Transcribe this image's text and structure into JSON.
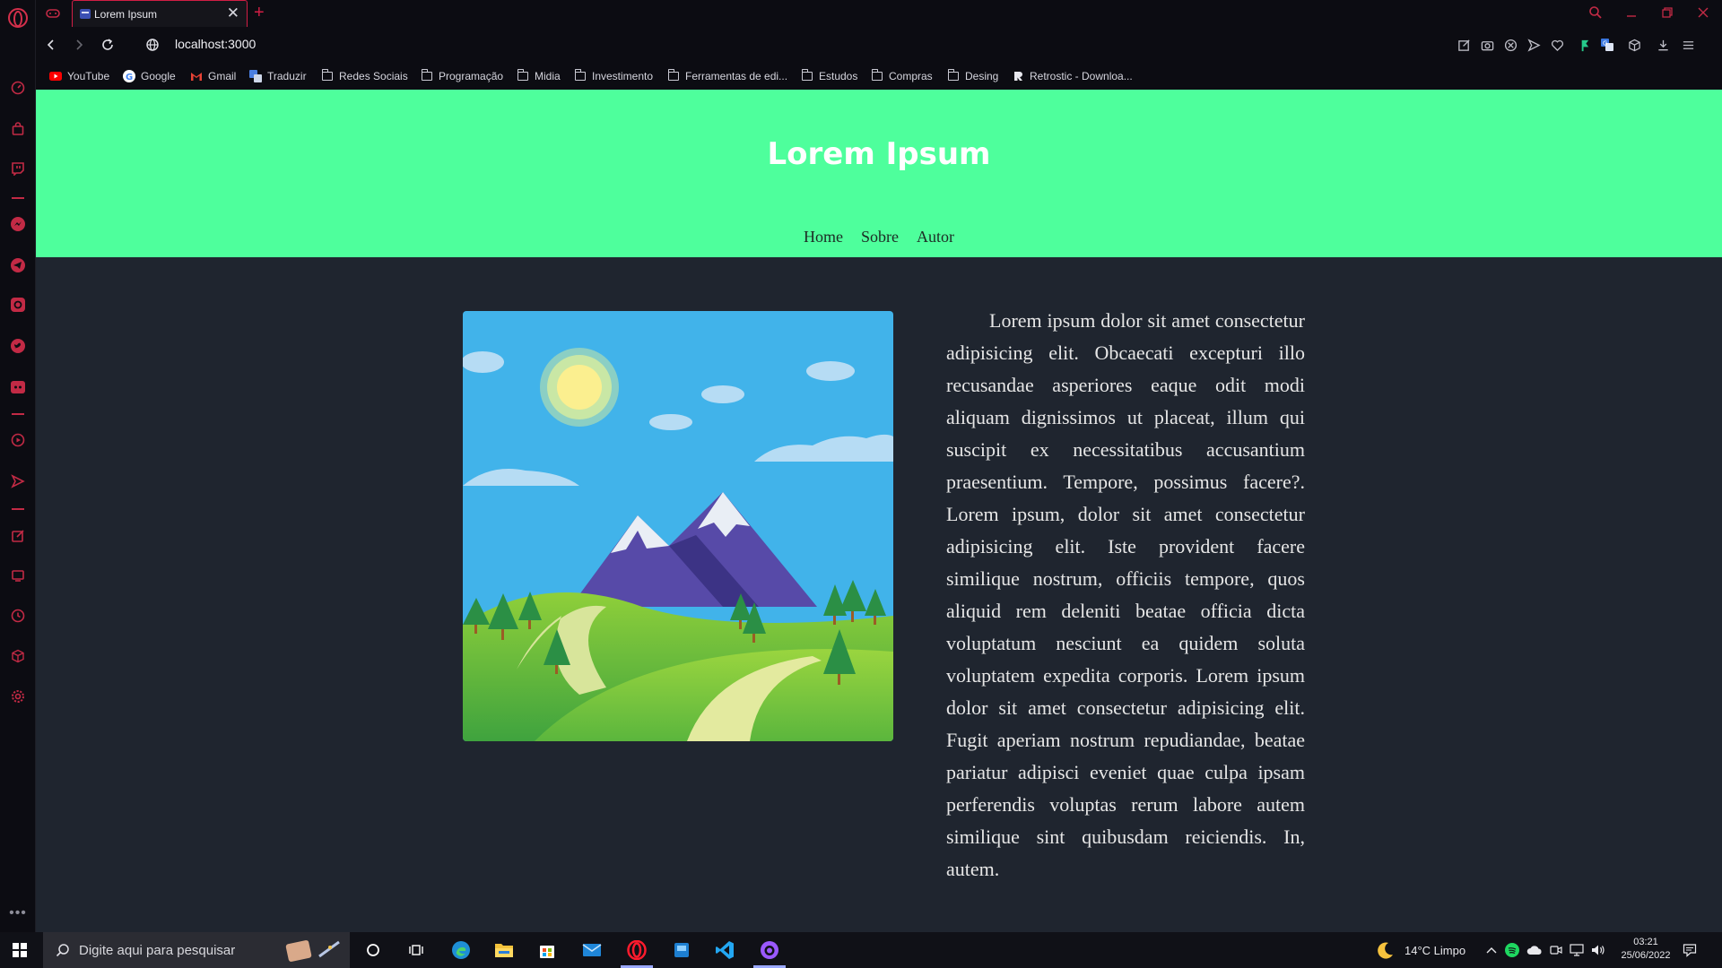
{
  "browser": {
    "tab_title": "Lorem Ipsum",
    "tab_close": "✕",
    "new_tab": "+",
    "url": "localhost:3000",
    "accent_color": "#d21e45"
  },
  "bookmarks": [
    {
      "label": "YouTube",
      "icon": "youtube-icon"
    },
    {
      "label": "Google",
      "icon": "google-icon"
    },
    {
      "label": "Gmail",
      "icon": "gmail-icon"
    },
    {
      "label": "Traduzir",
      "icon": "translate-icon"
    },
    {
      "label": "Redes Sociais",
      "icon": "folder-icon"
    },
    {
      "label": "Programação",
      "icon": "folder-icon"
    },
    {
      "label": "Midia",
      "icon": "folder-icon"
    },
    {
      "label": "Investimento",
      "icon": "folder-icon"
    },
    {
      "label": "Ferramentas de edi...",
      "icon": "folder-icon"
    },
    {
      "label": "Estudos",
      "icon": "folder-icon"
    },
    {
      "label": "Compras",
      "icon": "folder-icon"
    },
    {
      "label": "Desing",
      "icon": "folder-icon"
    },
    {
      "label": "Retrostic - Downloa...",
      "icon": "retrostic-icon"
    }
  ],
  "site": {
    "title": "Lorem Ipsum",
    "nav": [
      "Home",
      "Sobre",
      "Autor"
    ],
    "header_color": "#4eff9c",
    "body_color": "#1f252f",
    "article": "Lorem ipsum dolor sit amet consectetur adipisicing elit. Obcaecati excepturi illo recusandae asperiores eaque odit modi aliquam dignissimos ut placeat, illum qui suscipit ex necessitatibus accusantium praesentium. Tempore, possimus facere?. Lorem ipsum, dolor sit amet consectetur adipisicing elit. Iste provident facere similique nostrum, officiis tempore, quos aliquid rem deleniti beatae officia dicta voluptatum nesciunt ea quidem soluta voluptatem expedita corporis. Lorem ipsum dolor sit amet consectetur adipisicing elit. Fugit aperiam nostrum repudiandae, beatae pariatur adipisci eveniet quae culpa ipsam perferendis voluptas rerum labore autem similique sint quibusdam reiciendis. In, autem."
  },
  "taskbar": {
    "search_placeholder": "Digite aqui para pesquisar",
    "weather": "14°C  Limpo",
    "time": "03:21",
    "date": "25/06/2022",
    "apps": [
      "cortana-icon",
      "task-view-icon",
      "edge-icon",
      "file-explorer-icon",
      "store-icon",
      "mail-icon",
      "opera-icon",
      "app-icon",
      "vscode-icon",
      "github-desktop-icon"
    ]
  }
}
